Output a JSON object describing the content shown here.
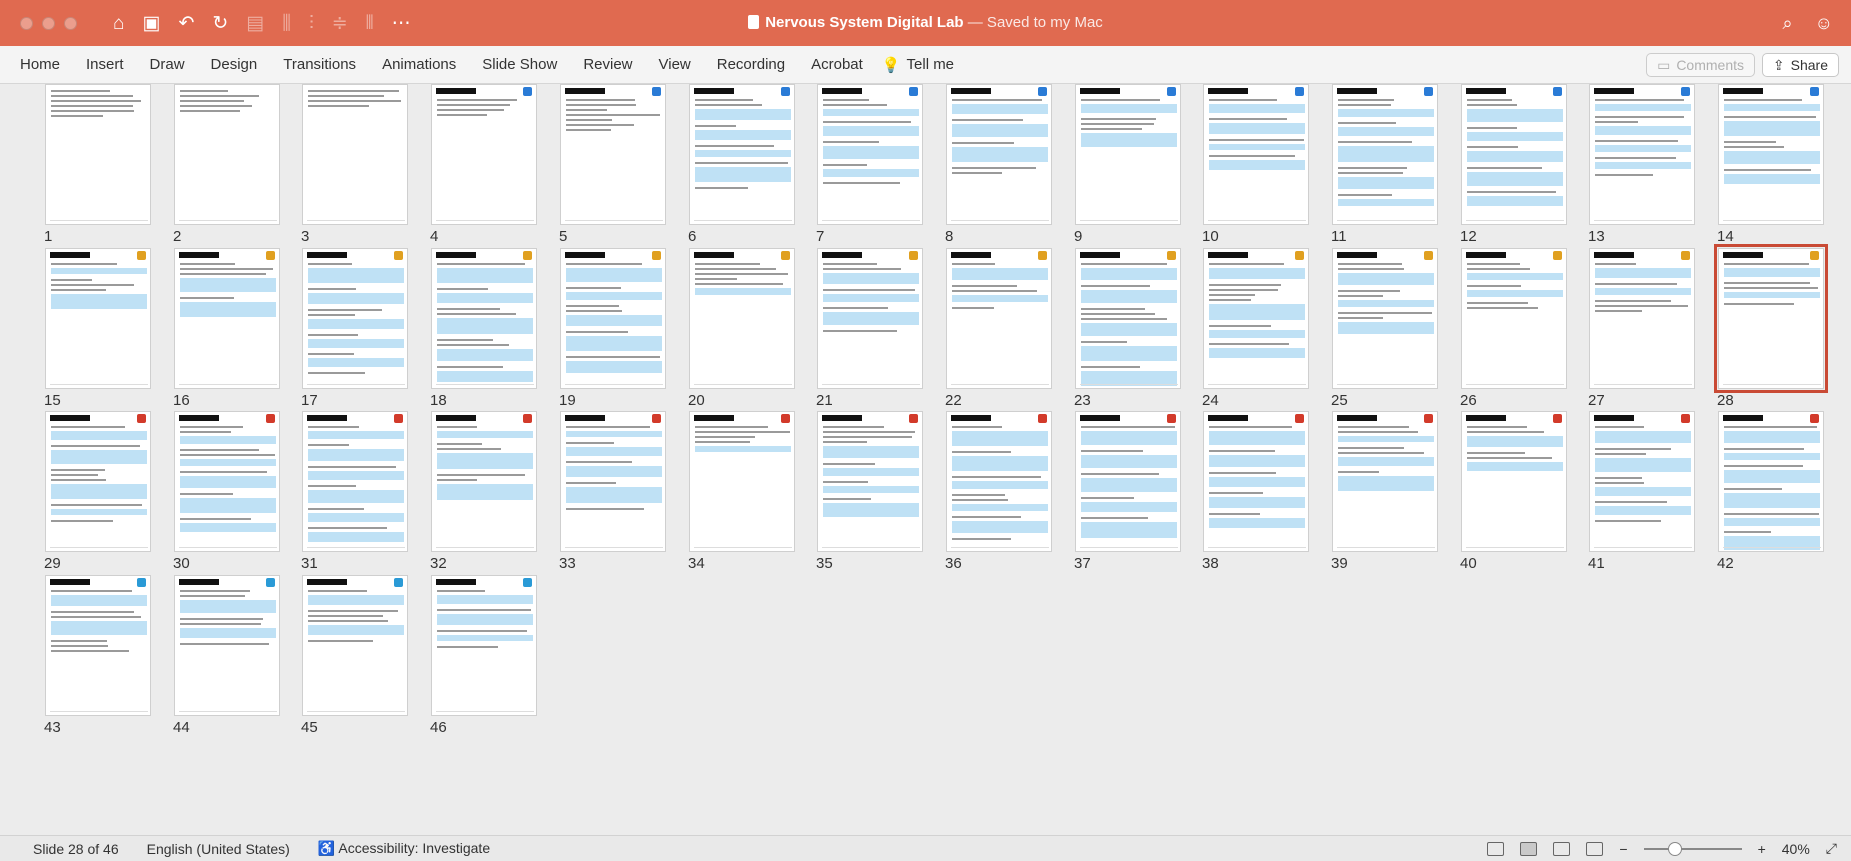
{
  "window": {
    "title": "Nervous System Digital Lab",
    "saved_status": "— Saved to my Mac",
    "quick_access": {
      "more_label": "⋯"
    }
  },
  "ribbon": {
    "tabs": [
      "Home",
      "Insert",
      "Draw",
      "Design",
      "Transitions",
      "Animations",
      "Slide Show",
      "Review",
      "View",
      "Recording",
      "Acrobat"
    ],
    "tell_me": "Tell me",
    "comments_label": "Comments",
    "share_label": "Share"
  },
  "sorter": {
    "slide_count": 46,
    "selected_slide": 28,
    "slides": [
      "1",
      "2",
      "3",
      "4",
      "5",
      "6",
      "7",
      "8",
      "9",
      "10",
      "11",
      "12",
      "13",
      "14",
      "15",
      "16",
      "17",
      "18",
      "19",
      "20",
      "21",
      "22",
      "23",
      "24",
      "25",
      "26",
      "27",
      "28",
      "29",
      "30",
      "31",
      "32",
      "33",
      "34",
      "35",
      "36",
      "37",
      "38",
      "39",
      "40",
      "41",
      "42",
      "43",
      "44",
      "45",
      "46"
    ]
  },
  "status": {
    "slide_position": "Slide 28 of 46",
    "language": "English (United States)",
    "accessibility": "Accessibility: Investigate",
    "zoom_minus": "−",
    "zoom_plus": "+",
    "zoom_level": "40%"
  },
  "colors": {
    "title_bar": "#e06a50",
    "slide_fill": "#bfe1f5",
    "selected_outline": "#c94a35"
  }
}
